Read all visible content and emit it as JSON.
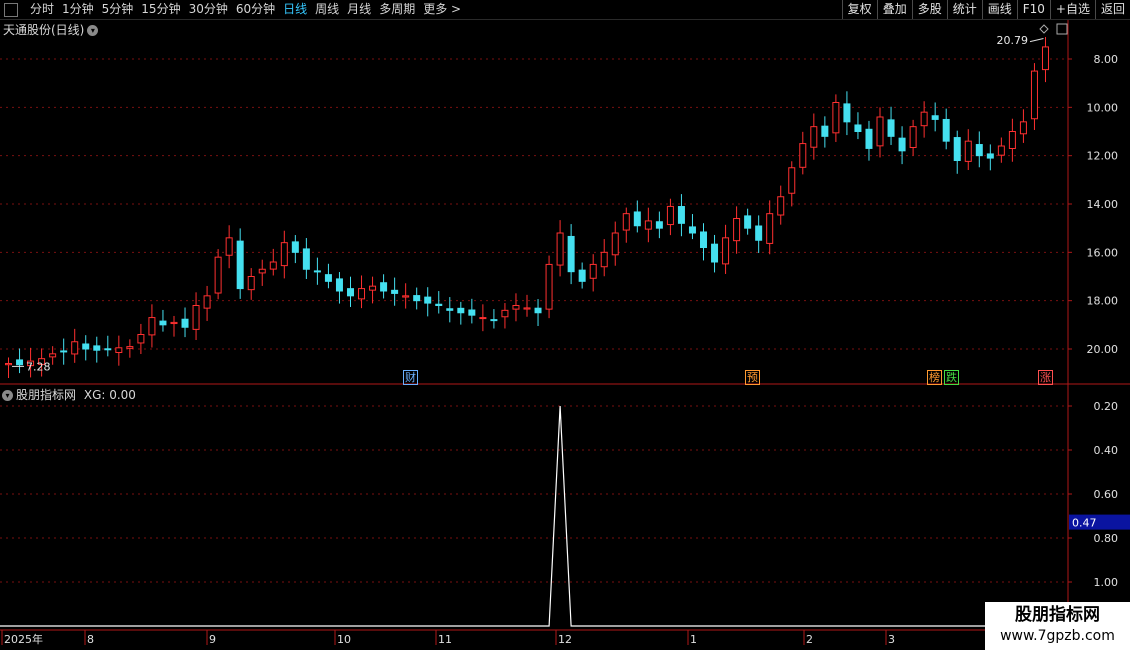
{
  "toolbar": {
    "periods": [
      "分时",
      "1分钟",
      "5分钟",
      "15分钟",
      "30分钟",
      "60分钟",
      "日线",
      "周线",
      "月线",
      "多周期",
      "更多 >"
    ],
    "active_period": "日线",
    "right_buttons": [
      "复权",
      "叠加",
      "多股",
      "统计",
      "画线",
      "F10",
      "+自选",
      "返回"
    ]
  },
  "main_pane": {
    "title": "天通股份(日线)",
    "price_ticks": [
      "20.00",
      "18.00",
      "16.00",
      "14.00",
      "12.00",
      "10.00",
      "8.00"
    ],
    "high_label": "20.79",
    "low_label": "7.28",
    "event_marks": [
      {
        "label": "财",
        "color": "#6ab0ff"
      },
      {
        "label": "预",
        "color": "#ff9a30"
      },
      {
        "label": "榜",
        "color": "#ff9a30"
      },
      {
        "label": "跌",
        "color": "#44dd44"
      },
      {
        "label": "涨",
        "color": "#ff5050"
      }
    ]
  },
  "indicator_pane": {
    "title": "股朋指标网",
    "formula": "XG: 0.00",
    "ticks": [
      "1.00",
      "0.80",
      "0.60",
      "0.40",
      "0.20"
    ],
    "current_value": "0.47"
  },
  "time_axis": {
    "labels": [
      "2025年",
      "8",
      "9",
      "10",
      "11",
      "12",
      "1",
      "2",
      "3"
    ]
  },
  "watermark": {
    "line1": "股朋指标网",
    "line2": "www.7gpzb.com"
  },
  "colors": {
    "up": "#ff3030",
    "down": "#45e0f0",
    "grid": "#7a1010",
    "axis": "#b01818",
    "toolbar_active": "#35c8ff",
    "indicator_line": "#ffffff",
    "value_box": "#0a14a0"
  },
  "chart_data": [
    {
      "type": "candlestick",
      "title": "天通股份(日线)",
      "ylim": [
        7,
        21
      ],
      "y_ticks": [
        8,
        10,
        12,
        14,
        16,
        18,
        20
      ],
      "x_labels": [
        "2025年",
        "8",
        "9",
        "10",
        "11",
        "12",
        "1",
        "2",
        "3"
      ],
      "grid": true,
      "high": 20.79,
      "low": 7.28,
      "series": [
        {
          "name": "close",
          "values": [
            7.4,
            7.35,
            7.5,
            7.6,
            7.8,
            7.9,
            8.3,
            8.0,
            7.95,
            8.0,
            8.05,
            8.1,
            8.6,
            9.3,
            9.0,
            9.1,
            8.9,
            9.8,
            10.2,
            11.8,
            12.6,
            10.5,
            11.0,
            11.3,
            11.6,
            12.4,
            12.0,
            11.3,
            11.2,
            10.8,
            10.4,
            10.2,
            10.5,
            10.6,
            10.4,
            10.3,
            10.2,
            10.0,
            9.9,
            9.8,
            9.6,
            9.5,
            9.4,
            9.3,
            9.2,
            9.6,
            9.8,
            9.7,
            9.5,
            11.5,
            12.8,
            11.2,
            10.8,
            11.5,
            12.0,
            12.8,
            13.6,
            13.1,
            13.3,
            13.0,
            13.9,
            13.2,
            12.8,
            12.2,
            11.6,
            12.6,
            13.4,
            13.0,
            12.5,
            13.6,
            14.3,
            15.5,
            16.5,
            17.2,
            16.8,
            18.2,
            17.4,
            17.0,
            16.3,
            17.6,
            16.8,
            16.2,
            17.2,
            17.8,
            17.5,
            16.6,
            15.8,
            16.6,
            16.0,
            15.9,
            16.4,
            17.0,
            17.4,
            19.5,
            20.5
          ]
        }
      ]
    },
    {
      "type": "line",
      "title": "股朋指标网",
      "series": [
        {
          "name": "XG",
          "values": [
            0,
            0,
            0,
            0,
            0,
            0,
            0,
            0,
            0,
            0,
            0,
            0,
            0,
            0,
            0,
            0,
            0,
            0,
            0,
            0,
            0,
            0,
            0,
            0,
            0,
            0,
            0,
            0,
            0,
            0,
            0,
            0,
            0,
            0,
            0,
            0,
            0,
            0,
            0,
            0,
            0,
            0,
            0,
            0,
            0,
            0,
            0,
            0,
            0,
            0,
            1,
            0,
            0,
            0,
            0,
            0,
            0,
            0,
            0,
            0,
            0,
            0,
            0,
            0,
            0,
            0,
            0,
            0,
            0,
            0,
            0,
            0,
            0,
            0,
            0,
            0,
            0,
            0,
            0,
            0,
            0,
            0,
            0,
            0,
            0,
            0,
            0,
            0,
            0,
            0,
            0,
            0,
            0,
            0,
            0
          ]
        }
      ],
      "ylim": [
        0,
        1.1
      ],
      "y_ticks": [
        0.2,
        0.4,
        0.6,
        0.8,
        1.0
      ],
      "current": 0.47
    }
  ]
}
